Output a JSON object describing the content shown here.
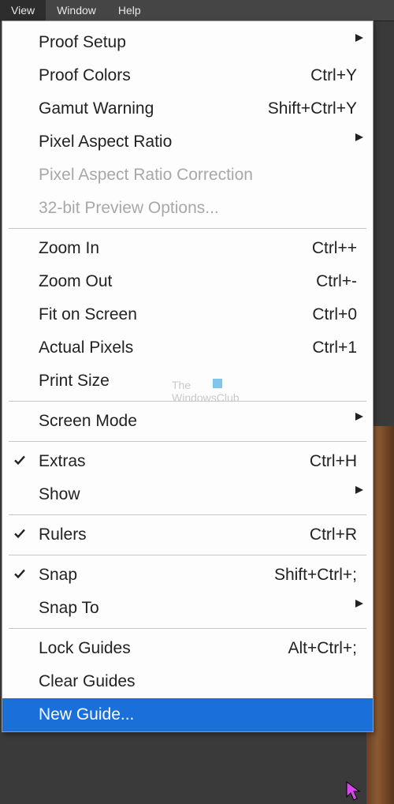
{
  "menubar": {
    "view": "View",
    "window": "Window",
    "help": "Help"
  },
  "menu": {
    "proof_setup": "Proof Setup",
    "proof_colors": "Proof Colors",
    "proof_colors_sc": "Ctrl+Y",
    "gamut_warning": "Gamut Warning",
    "gamut_warning_sc": "Shift+Ctrl+Y",
    "pixel_aspect": "Pixel Aspect Ratio",
    "pixel_aspect_corr": "Pixel Aspect Ratio Correction",
    "preview_32bit": "32-bit Preview Options...",
    "zoom_in": "Zoom In",
    "zoom_in_sc": "Ctrl++",
    "zoom_out": "Zoom Out",
    "zoom_out_sc": "Ctrl+-",
    "fit_on_screen": "Fit on Screen",
    "fit_on_screen_sc": "Ctrl+0",
    "actual_pixels": "Actual Pixels",
    "actual_pixels_sc": "Ctrl+1",
    "print_size": "Print Size",
    "screen_mode": "Screen Mode",
    "extras": "Extras",
    "extras_sc": "Ctrl+H",
    "show": "Show",
    "rulers": "Rulers",
    "rulers_sc": "Ctrl+R",
    "snap": "Snap",
    "snap_sc": "Shift+Ctrl+;",
    "snap_to": "Snap To",
    "lock_guides": "Lock Guides",
    "lock_guides_sc": "Alt+Ctrl+;",
    "clear_guides": "Clear Guides",
    "new_guide": "New Guide..."
  },
  "watermark": {
    "line1": "The",
    "line2": "WindowsClub"
  }
}
